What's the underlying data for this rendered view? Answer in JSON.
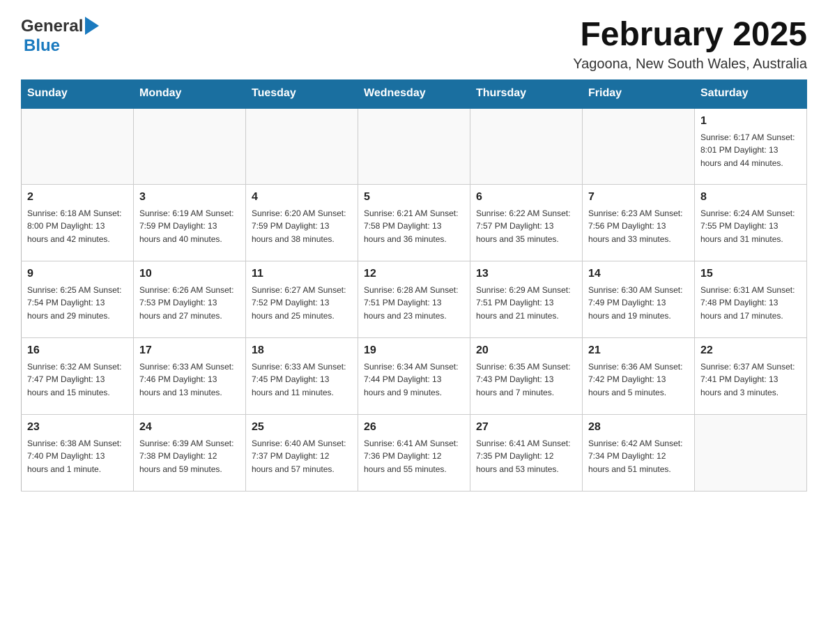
{
  "header": {
    "logo_general": "General",
    "logo_blue": "Blue",
    "month_title": "February 2025",
    "location": "Yagoona, New South Wales, Australia"
  },
  "weekdays": [
    "Sunday",
    "Monday",
    "Tuesday",
    "Wednesday",
    "Thursday",
    "Friday",
    "Saturday"
  ],
  "weeks": [
    [
      {
        "day": "",
        "info": ""
      },
      {
        "day": "",
        "info": ""
      },
      {
        "day": "",
        "info": ""
      },
      {
        "day": "",
        "info": ""
      },
      {
        "day": "",
        "info": ""
      },
      {
        "day": "",
        "info": ""
      },
      {
        "day": "1",
        "info": "Sunrise: 6:17 AM\nSunset: 8:01 PM\nDaylight: 13 hours and 44 minutes."
      }
    ],
    [
      {
        "day": "2",
        "info": "Sunrise: 6:18 AM\nSunset: 8:00 PM\nDaylight: 13 hours and 42 minutes."
      },
      {
        "day": "3",
        "info": "Sunrise: 6:19 AM\nSunset: 7:59 PM\nDaylight: 13 hours and 40 minutes."
      },
      {
        "day": "4",
        "info": "Sunrise: 6:20 AM\nSunset: 7:59 PM\nDaylight: 13 hours and 38 minutes."
      },
      {
        "day": "5",
        "info": "Sunrise: 6:21 AM\nSunset: 7:58 PM\nDaylight: 13 hours and 36 minutes."
      },
      {
        "day": "6",
        "info": "Sunrise: 6:22 AM\nSunset: 7:57 PM\nDaylight: 13 hours and 35 minutes."
      },
      {
        "day": "7",
        "info": "Sunrise: 6:23 AM\nSunset: 7:56 PM\nDaylight: 13 hours and 33 minutes."
      },
      {
        "day": "8",
        "info": "Sunrise: 6:24 AM\nSunset: 7:55 PM\nDaylight: 13 hours and 31 minutes."
      }
    ],
    [
      {
        "day": "9",
        "info": "Sunrise: 6:25 AM\nSunset: 7:54 PM\nDaylight: 13 hours and 29 minutes."
      },
      {
        "day": "10",
        "info": "Sunrise: 6:26 AM\nSunset: 7:53 PM\nDaylight: 13 hours and 27 minutes."
      },
      {
        "day": "11",
        "info": "Sunrise: 6:27 AM\nSunset: 7:52 PM\nDaylight: 13 hours and 25 minutes."
      },
      {
        "day": "12",
        "info": "Sunrise: 6:28 AM\nSunset: 7:51 PM\nDaylight: 13 hours and 23 minutes."
      },
      {
        "day": "13",
        "info": "Sunrise: 6:29 AM\nSunset: 7:51 PM\nDaylight: 13 hours and 21 minutes."
      },
      {
        "day": "14",
        "info": "Sunrise: 6:30 AM\nSunset: 7:49 PM\nDaylight: 13 hours and 19 minutes."
      },
      {
        "day": "15",
        "info": "Sunrise: 6:31 AM\nSunset: 7:48 PM\nDaylight: 13 hours and 17 minutes."
      }
    ],
    [
      {
        "day": "16",
        "info": "Sunrise: 6:32 AM\nSunset: 7:47 PM\nDaylight: 13 hours and 15 minutes."
      },
      {
        "day": "17",
        "info": "Sunrise: 6:33 AM\nSunset: 7:46 PM\nDaylight: 13 hours and 13 minutes."
      },
      {
        "day": "18",
        "info": "Sunrise: 6:33 AM\nSunset: 7:45 PM\nDaylight: 13 hours and 11 minutes."
      },
      {
        "day": "19",
        "info": "Sunrise: 6:34 AM\nSunset: 7:44 PM\nDaylight: 13 hours and 9 minutes."
      },
      {
        "day": "20",
        "info": "Sunrise: 6:35 AM\nSunset: 7:43 PM\nDaylight: 13 hours and 7 minutes."
      },
      {
        "day": "21",
        "info": "Sunrise: 6:36 AM\nSunset: 7:42 PM\nDaylight: 13 hours and 5 minutes."
      },
      {
        "day": "22",
        "info": "Sunrise: 6:37 AM\nSunset: 7:41 PM\nDaylight: 13 hours and 3 minutes."
      }
    ],
    [
      {
        "day": "23",
        "info": "Sunrise: 6:38 AM\nSunset: 7:40 PM\nDaylight: 13 hours and 1 minute."
      },
      {
        "day": "24",
        "info": "Sunrise: 6:39 AM\nSunset: 7:38 PM\nDaylight: 12 hours and 59 minutes."
      },
      {
        "day": "25",
        "info": "Sunrise: 6:40 AM\nSunset: 7:37 PM\nDaylight: 12 hours and 57 minutes."
      },
      {
        "day": "26",
        "info": "Sunrise: 6:41 AM\nSunset: 7:36 PM\nDaylight: 12 hours and 55 minutes."
      },
      {
        "day": "27",
        "info": "Sunrise: 6:41 AM\nSunset: 7:35 PM\nDaylight: 12 hours and 53 minutes."
      },
      {
        "day": "28",
        "info": "Sunrise: 6:42 AM\nSunset: 7:34 PM\nDaylight: 12 hours and 51 minutes."
      },
      {
        "day": "",
        "info": ""
      }
    ]
  ]
}
